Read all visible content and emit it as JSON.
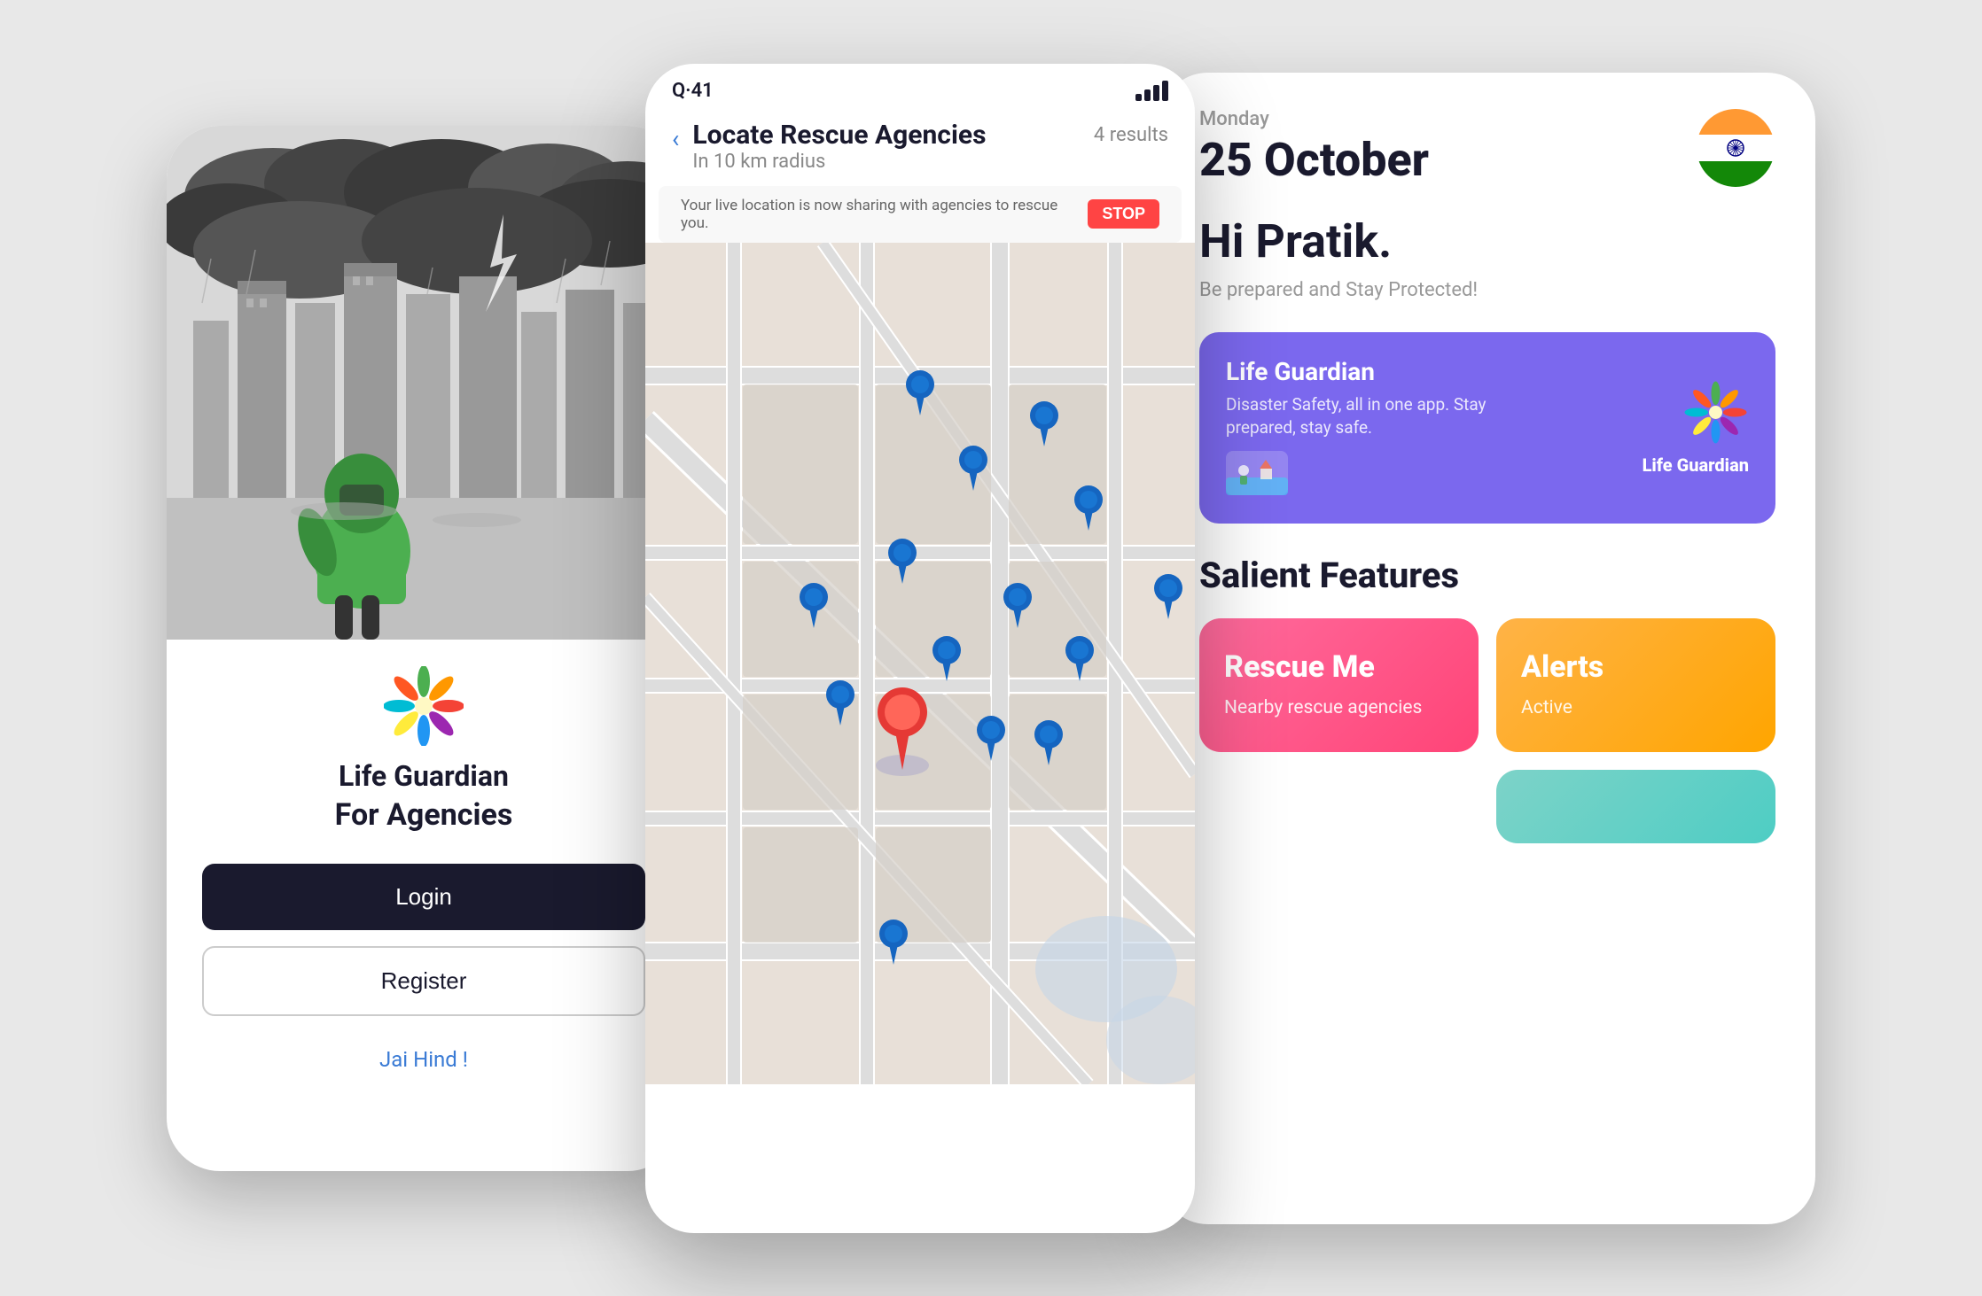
{
  "phone1": {
    "app_name": "Life Guardian",
    "app_subtitle": "For Agencies",
    "login_label": "Login",
    "register_label": "Register",
    "footer_text": "Jai Hind !"
  },
  "phone2": {
    "status_bar": {
      "time": "Q·41",
      "signal_label": "signal"
    },
    "header": {
      "title": "Locate Rescue Agencies",
      "subtitle": "In 10 km radius",
      "results": "4 results"
    },
    "banner_text": "Your live location is now sharing with agencies to rescue you.",
    "stop_label": "STOP"
  },
  "phone3": {
    "date_day": "Monday",
    "date_full": "25 October",
    "greeting": "Hi Pratik.",
    "tagline": "Be prepared and Stay Protected!",
    "banner": {
      "title": "Life Guardian",
      "description": "Disaster Safety, all in one app. Stay prepared, stay safe.",
      "logo_text": "Life Guardian"
    },
    "salient_features_title": "Salient Features",
    "features": [
      {
        "title": "Rescue Me",
        "subtitle": "Nearby rescue agencies",
        "color": "pink"
      },
      {
        "title": "Alerts",
        "subtitle": "Active",
        "color": "orange"
      },
      {
        "title": "",
        "subtitle": "",
        "color": "teal"
      }
    ]
  },
  "icons": {
    "back_arrow": "‹",
    "hands_emoji": "🤚"
  }
}
